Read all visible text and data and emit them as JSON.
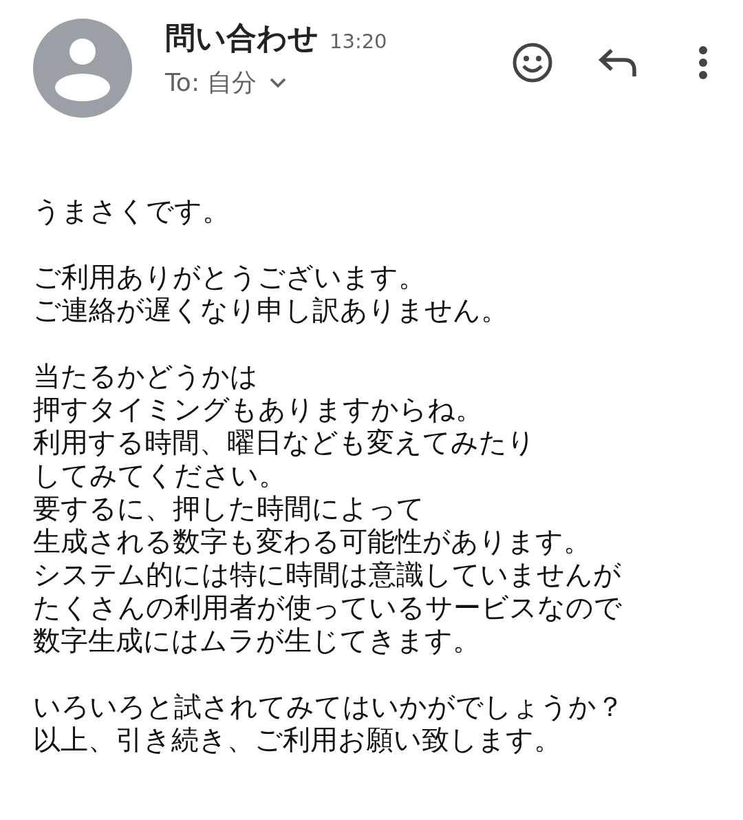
{
  "header": {
    "subject": "問い合わせ",
    "time": "13:20",
    "recipient": "To: 自分"
  },
  "body": {
    "paragraphs": [
      [
        "うまさくです。"
      ],
      [
        "ご利用ありがとうございます。",
        "ご連絡が遅くなり申し訳ありません。"
      ],
      [
        "当たるかどうかは",
        "押すタイミングもありますからね。",
        "利用する時間、曜日なども変えてみたり",
        "してみてください。",
        "要するに、押した時間によって",
        "生成される数字も変わる可能性があります。",
        "システム的には特に時間は意識していませんが",
        "たくさんの利用者が使っているサービスなので",
        "数字生成にはムラが生じてきます。"
      ],
      [
        "いろいろと試されてみてはいかがでしょうか？",
        "以上、引き続き、ご利用お願い致します。"
      ]
    ]
  }
}
